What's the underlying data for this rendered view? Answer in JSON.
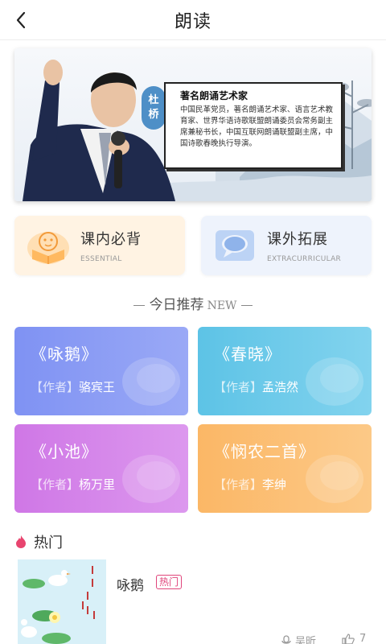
{
  "header": {
    "title": "朗读"
  },
  "banner": {
    "person_name": [
      "杜",
      "桥"
    ],
    "card_title": "著名朗诵艺术家",
    "card_text": "中国民革党员，著名朗诵艺术家、语言艺术教育家、世界华语诗歌联盟朗诵委员会常务副主席兼秘书长，中国互联网朗诵联盟副主席，中国诗歌春晚执行导演。"
  },
  "categories": [
    {
      "title": "课内必背",
      "subtitle": "ESSENTIAL",
      "color": "#fff3e3",
      "icon": "book-icon"
    },
    {
      "title": "课外拓展",
      "subtitle": "EXTRACURRICULAR",
      "color": "#eef3fc",
      "icon": "chat-bubble-icon"
    }
  ],
  "recommend": {
    "label": "今日推荐",
    "new_tag": "NEW"
  },
  "poems": [
    {
      "title": "《咏鹅》",
      "author_tag": "【作者】",
      "author": "骆宾王",
      "color_from": "#7f92f3",
      "color_to": "#9aa9f6"
    },
    {
      "title": "《春晓》",
      "author_tag": "【作者】",
      "author": "孟浩然",
      "color_from": "#5dc3e6",
      "color_to": "#82d3ee"
    },
    {
      "title": "《小池》",
      "author_tag": "【作者】",
      "author": "杨万里",
      "color_from": "#cf77e6",
      "color_to": "#dc98ee"
    },
    {
      "title": "《悯农二首》",
      "author_tag": "【作者】",
      "author": "李绅",
      "color_from": "#fbb766",
      "color_to": "#fcc987"
    }
  ],
  "hot": {
    "label": "热门",
    "item": {
      "title": "咏鹅",
      "badge": "热门",
      "listener": "吴昕",
      "likes": "7"
    }
  }
}
